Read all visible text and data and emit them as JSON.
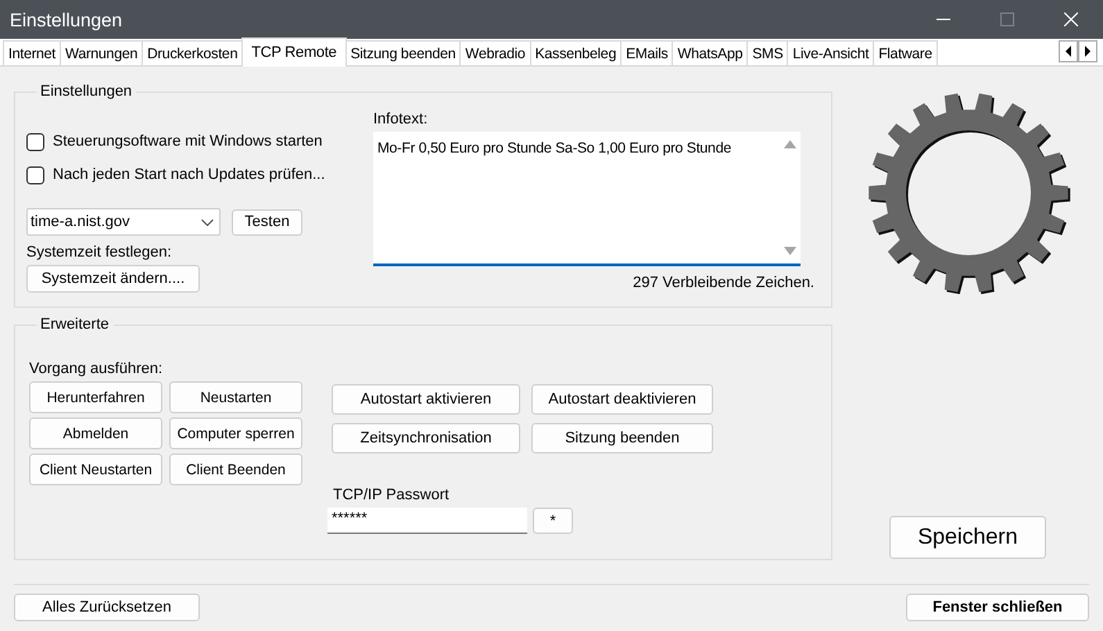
{
  "window": {
    "title": "Einstellungen"
  },
  "tabs": [
    {
      "label": "Internet",
      "selected": false
    },
    {
      "label": "Warnungen",
      "selected": false
    },
    {
      "label": "Druckerkosten",
      "selected": false
    },
    {
      "label": "TCP Remote",
      "selected": true
    },
    {
      "label": "Sitzung beenden",
      "selected": false
    },
    {
      "label": "Webradio",
      "selected": false
    },
    {
      "label": "Kassenbeleg",
      "selected": false
    },
    {
      "label": "EMails",
      "selected": false
    },
    {
      "label": "WhatsApp",
      "selected": false
    },
    {
      "label": "SMS",
      "selected": false
    },
    {
      "label": "Live-Ansicht",
      "selected": false
    },
    {
      "label": "Flatware",
      "selected": false
    }
  ],
  "settings_group": {
    "legend": "Einstellungen",
    "checkboxes": [
      {
        "label": "Steuerungsoftware mit Windows starten",
        "checked": false
      },
      {
        "label": "Nach jeden Start nach Updates prüfen...",
        "checked": false
      }
    ],
    "time_server": {
      "value": "time-a.nist.gov"
    },
    "test_button": "Testen",
    "system_time_label": "Systemzeit festlegen:",
    "system_time_button": "Systemzeit ändern....",
    "infotext": {
      "label": "Infotext:",
      "value": "Mo-Fr 0,50 Euro pro Stunde Sa-So 1,00 Euro pro Stunde"
    },
    "remaining_chars": "297 Verbleibende Zeichen."
  },
  "advanced_group": {
    "legend": "Erweiterte",
    "actions_label": "Vorgang ausführen:",
    "action_buttons": [
      "Herunterfahren",
      "Neustarten",
      "Abmelden",
      "Computer sperren",
      "Client Neustarten",
      "Client Beenden"
    ],
    "autostart_buttons": [
      "Autostart aktivieren",
      "Autostart deaktivieren",
      "Zeitsynchronisation",
      "Sitzung beenden"
    ],
    "password": {
      "label": "TCP/IP Passwort",
      "value": "******",
      "reveal_button": "*"
    }
  },
  "save_button": "Speichern",
  "reset_button": "Alles Zurücksetzen",
  "close_button": "Fenster schließen"
}
